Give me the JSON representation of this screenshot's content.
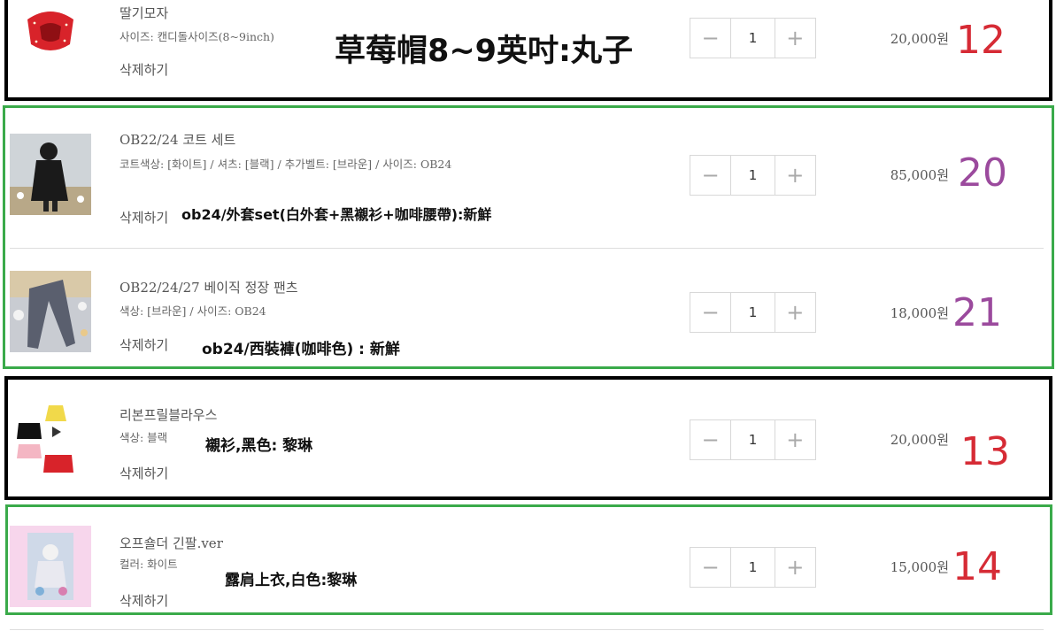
{
  "colors": {
    "red_number": "#d62b35",
    "purple_number": "#9b4a9d",
    "green_frame": "#3aaa4a",
    "black_frame": "#000000"
  },
  "items": [
    {
      "name": "딸기모자",
      "option": "사이즈: 캔디돌사이즈(8~9inch)",
      "delete": "삭제하기",
      "qty": "1",
      "price": "20,000원",
      "note": "草莓帽8~9英吋:丸子",
      "number": "12"
    },
    {
      "name": "OB22/24 코트 세트",
      "option": "코트색상: [화이트] / 셔츠: [블랙] / 추가벨트: [브라운] / 사이즈: OB24",
      "delete": "삭제하기",
      "qty": "1",
      "price": "85,000원",
      "note": "ob24/外套set(白外套+黑襯衫+咖啡腰帶):新鮮",
      "number": "20"
    },
    {
      "name": "OB22/24/27 베이직 정장 팬츠",
      "option": "색상: [브라운] / 사이즈: OB24",
      "delete": "삭제하기",
      "qty": "1",
      "price": "18,000원",
      "note": "ob24/西裝褲(咖啡色) : 新鮮",
      "number": "21"
    },
    {
      "name": "리본프릴블라우스",
      "option": "색상: 블랙",
      "delete": "삭제하기",
      "qty": "1",
      "price": "20,000원",
      "note": "襯衫,黑色: 黎琳",
      "number": "13"
    },
    {
      "name": "오프숄더 긴팔.ver",
      "option": "컬러: 화이트",
      "delete": "삭제하기",
      "qty": "1",
      "price": "15,000원",
      "note": "露肩上衣,白色:黎琳",
      "number": "14"
    }
  ],
  "stepper": {
    "minus": "−",
    "plus": "+"
  }
}
